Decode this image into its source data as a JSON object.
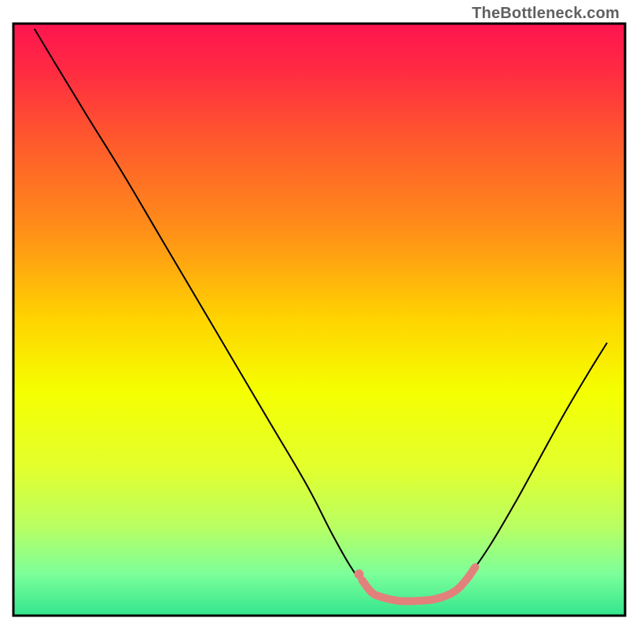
{
  "watermark": "TheBottleneck.com",
  "chart_data": {
    "type": "line",
    "title": "",
    "xlabel": "",
    "ylabel": "",
    "xlim": [
      0,
      100
    ],
    "ylim": [
      0,
      100
    ],
    "background_gradient": {
      "stops": [
        {
          "offset": 0.0,
          "color": "#ff1450"
        },
        {
          "offset": 0.08,
          "color": "#ff2b42"
        },
        {
          "offset": 0.2,
          "color": "#ff5a2c"
        },
        {
          "offset": 0.35,
          "color": "#ff8f18"
        },
        {
          "offset": 0.5,
          "color": "#ffd400"
        },
        {
          "offset": 0.62,
          "color": "#f5ff00"
        },
        {
          "offset": 0.75,
          "color": "#e2ff2d"
        },
        {
          "offset": 0.85,
          "color": "#b9ff63"
        },
        {
          "offset": 0.93,
          "color": "#7cff9a"
        },
        {
          "offset": 1.0,
          "color": "#33e58e"
        }
      ]
    },
    "series": [
      {
        "name": "bottleneck-curve",
        "color": "#000000",
        "width": 2,
        "points": [
          {
            "x": 3.5,
            "y": 99.0
          },
          {
            "x": 7.0,
            "y": 93.0
          },
          {
            "x": 12.0,
            "y": 84.5
          },
          {
            "x": 18.0,
            "y": 74.5
          },
          {
            "x": 24.0,
            "y": 64.0
          },
          {
            "x": 30.0,
            "y": 53.5
          },
          {
            "x": 36.0,
            "y": 43.0
          },
          {
            "x": 42.0,
            "y": 32.5
          },
          {
            "x": 48.0,
            "y": 22.0
          },
          {
            "x": 52.0,
            "y": 14.0
          },
          {
            "x": 55.0,
            "y": 8.5
          },
          {
            "x": 57.5,
            "y": 5.0
          },
          {
            "x": 60.0,
            "y": 3.2
          },
          {
            "x": 63.0,
            "y": 2.5
          },
          {
            "x": 66.0,
            "y": 2.5
          },
          {
            "x": 69.0,
            "y": 2.8
          },
          {
            "x": 72.0,
            "y": 4.0
          },
          {
            "x": 75.0,
            "y": 7.5
          },
          {
            "x": 78.0,
            "y": 12.0
          },
          {
            "x": 82.0,
            "y": 19.0
          },
          {
            "x": 86.0,
            "y": 26.5
          },
          {
            "x": 90.0,
            "y": 34.0
          },
          {
            "x": 94.0,
            "y": 41.0
          },
          {
            "x": 97.0,
            "y": 46.0
          }
        ]
      },
      {
        "name": "optimal-band-highlight",
        "color": "#e2817c",
        "width": 10,
        "points": [
          {
            "x": 57.0,
            "y": 6.0
          },
          {
            "x": 58.5,
            "y": 4.0
          },
          {
            "x": 60.0,
            "y": 3.2
          },
          {
            "x": 63.0,
            "y": 2.5
          },
          {
            "x": 66.0,
            "y": 2.5
          },
          {
            "x": 69.0,
            "y": 2.8
          },
          {
            "x": 72.0,
            "y": 4.0
          },
          {
            "x": 74.0,
            "y": 6.0
          },
          {
            "x": 75.5,
            "y": 8.2
          }
        ]
      }
    ],
    "markers": [
      {
        "name": "marker-dot",
        "x": 56.5,
        "y": 7.0,
        "r": 6,
        "color": "#e2817c"
      }
    ],
    "frame": {
      "color": "#000000",
      "width": 3
    }
  }
}
